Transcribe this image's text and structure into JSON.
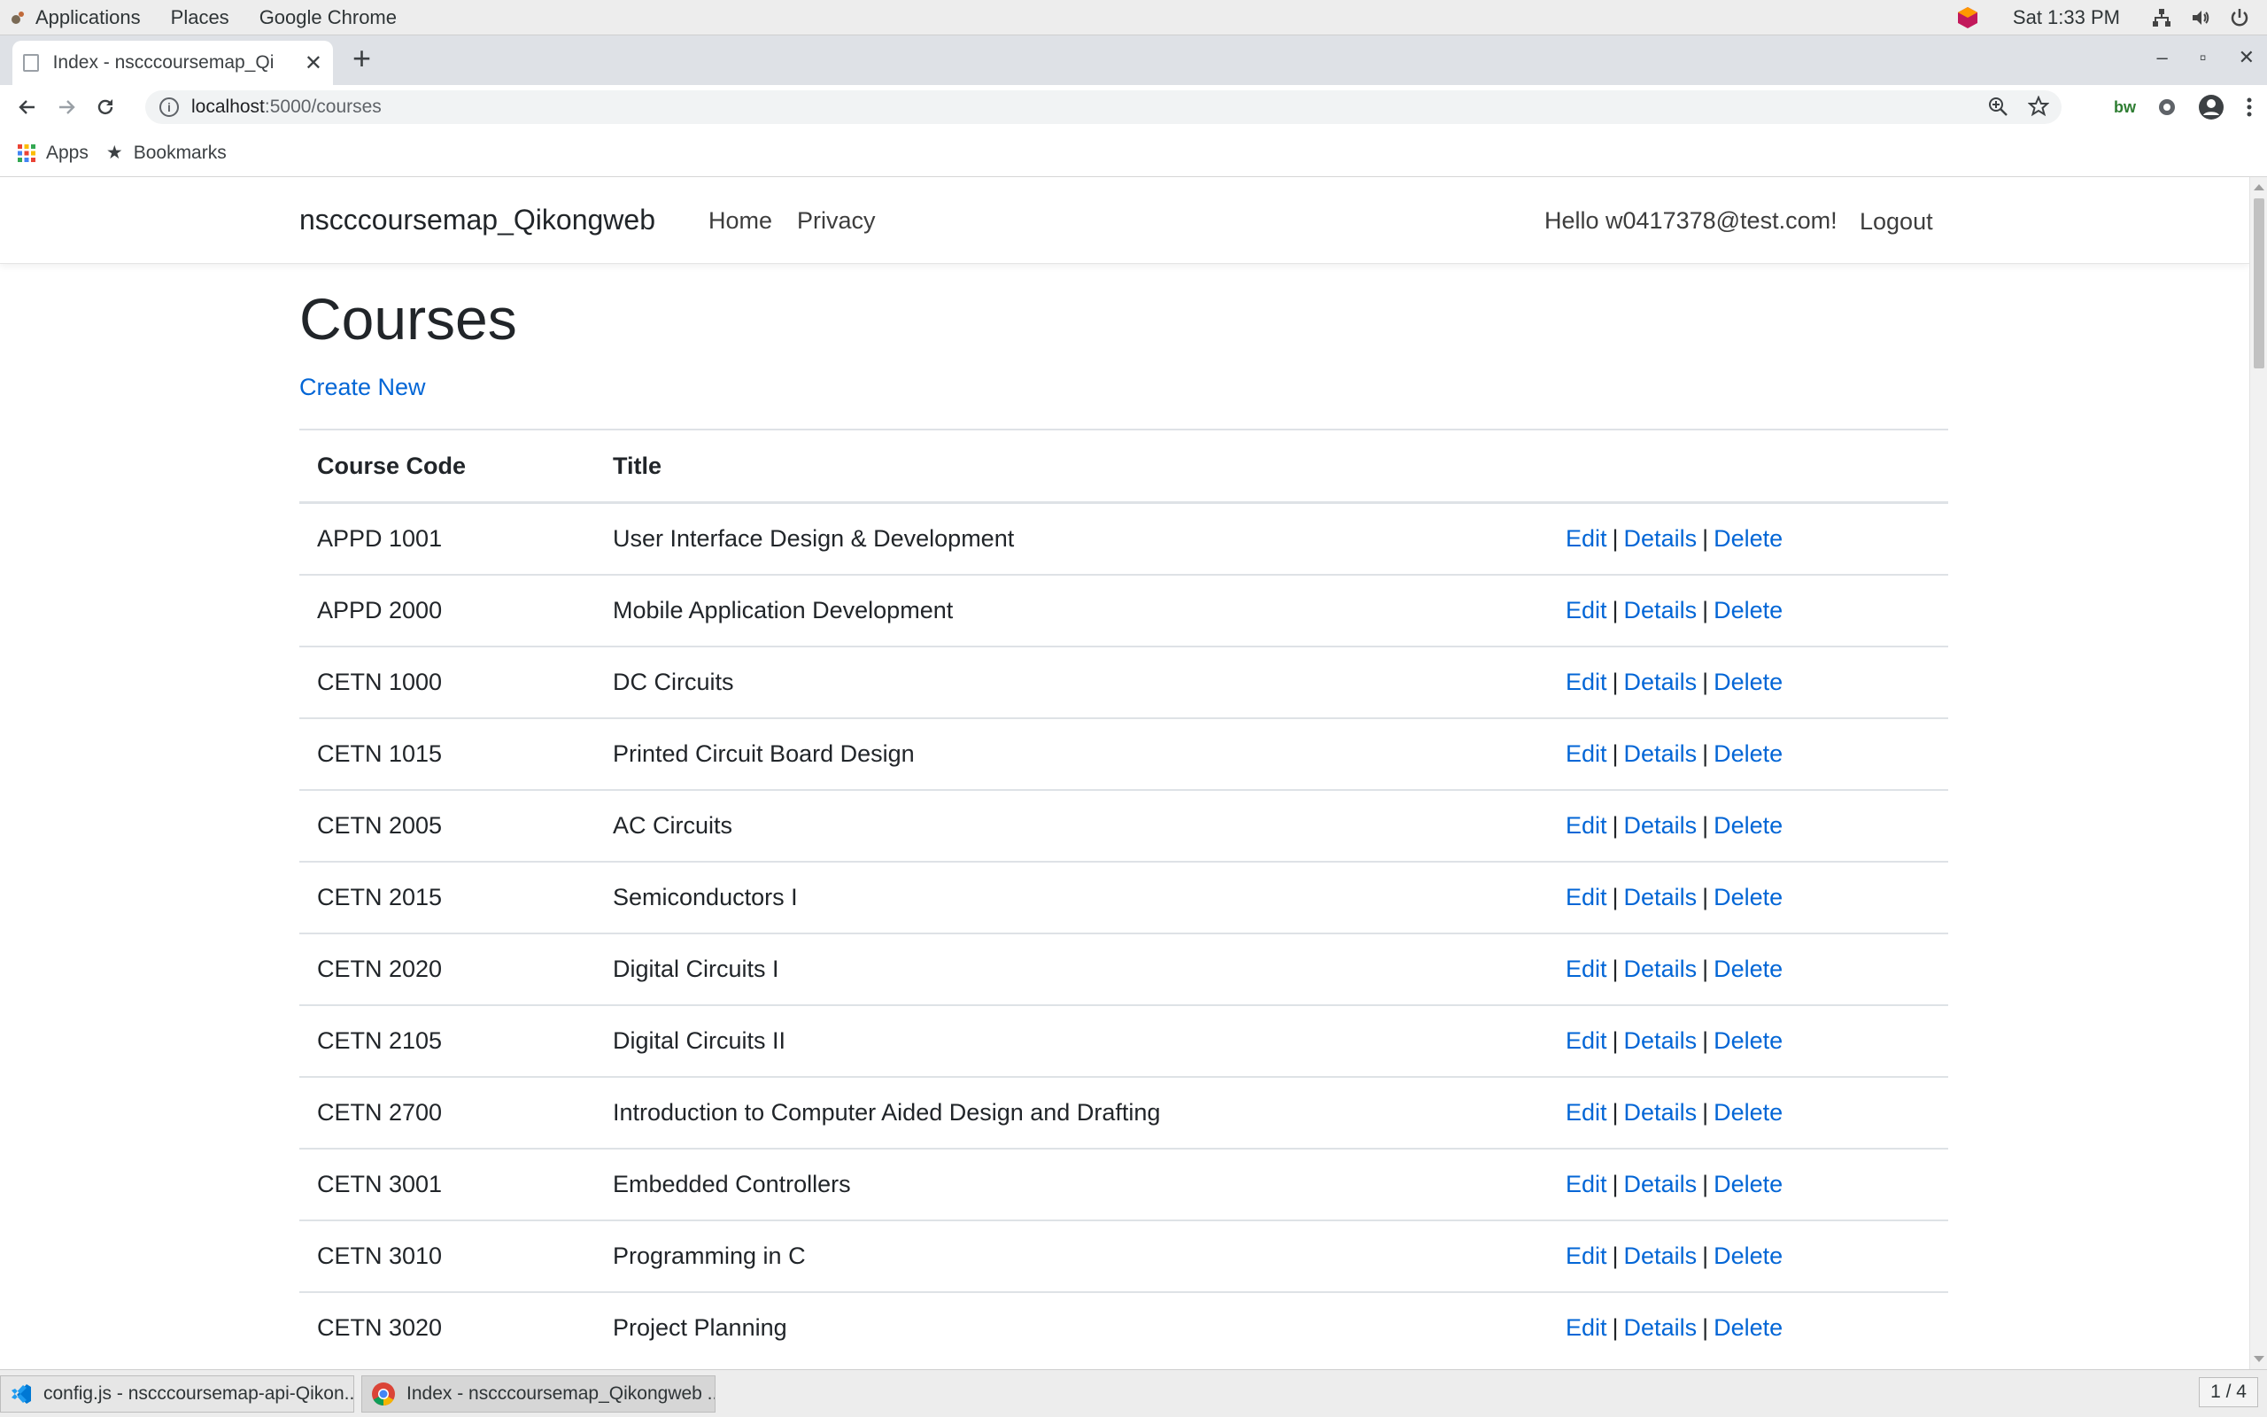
{
  "gnome": {
    "menus": [
      "Applications",
      "Places",
      "Google Chrome"
    ],
    "clock": "Sat  1:33 PM"
  },
  "chrome": {
    "tab_title": "Index - nscccoursemap_Qi",
    "url_host": "localhost",
    "url_path": ":5000/courses",
    "bookmarks": {
      "apps": "Apps",
      "bookmarks": "Bookmarks"
    }
  },
  "site": {
    "brand": "nscccoursemap_Qikongweb",
    "nav": {
      "home": "Home",
      "privacy": "Privacy"
    },
    "greeting": "Hello w0417378@test.com!",
    "logout": "Logout"
  },
  "page": {
    "title": "Courses",
    "create_new": "Create New",
    "columns": {
      "code": "Course Code",
      "title": "Title"
    },
    "action_labels": {
      "edit": "Edit",
      "details": "Details",
      "delete": "Delete",
      "sep": "|"
    },
    "courses": [
      {
        "code": "APPD 1001",
        "title": "User Interface Design & Development"
      },
      {
        "code": "APPD 2000",
        "title": "Mobile Application Development"
      },
      {
        "code": "CETN 1000",
        "title": "DC Circuits"
      },
      {
        "code": "CETN 1015",
        "title": "Printed Circuit Board Design"
      },
      {
        "code": "CETN 2005",
        "title": "AC Circuits"
      },
      {
        "code": "CETN 2015",
        "title": "Semiconductors I"
      },
      {
        "code": "CETN 2020",
        "title": "Digital Circuits I"
      },
      {
        "code": "CETN 2105",
        "title": "Digital Circuits II"
      },
      {
        "code": "CETN 2700",
        "title": "Introduction to Computer Aided Design and Drafting"
      },
      {
        "code": "CETN 3001",
        "title": "Embedded Controllers"
      },
      {
        "code": "CETN 3010",
        "title": "Programming in C"
      },
      {
        "code": "CETN 3020",
        "title": "Project Planning"
      }
    ]
  },
  "taskbar": {
    "items": [
      "config.js - nscccoursemap-api-Qikon...",
      "Index - nscccoursemap_Qikongweb ..."
    ],
    "pager": "1 / 4"
  },
  "colors": {
    "link": "#0366d6",
    "text": "#212529",
    "border": "#dee2e6"
  }
}
